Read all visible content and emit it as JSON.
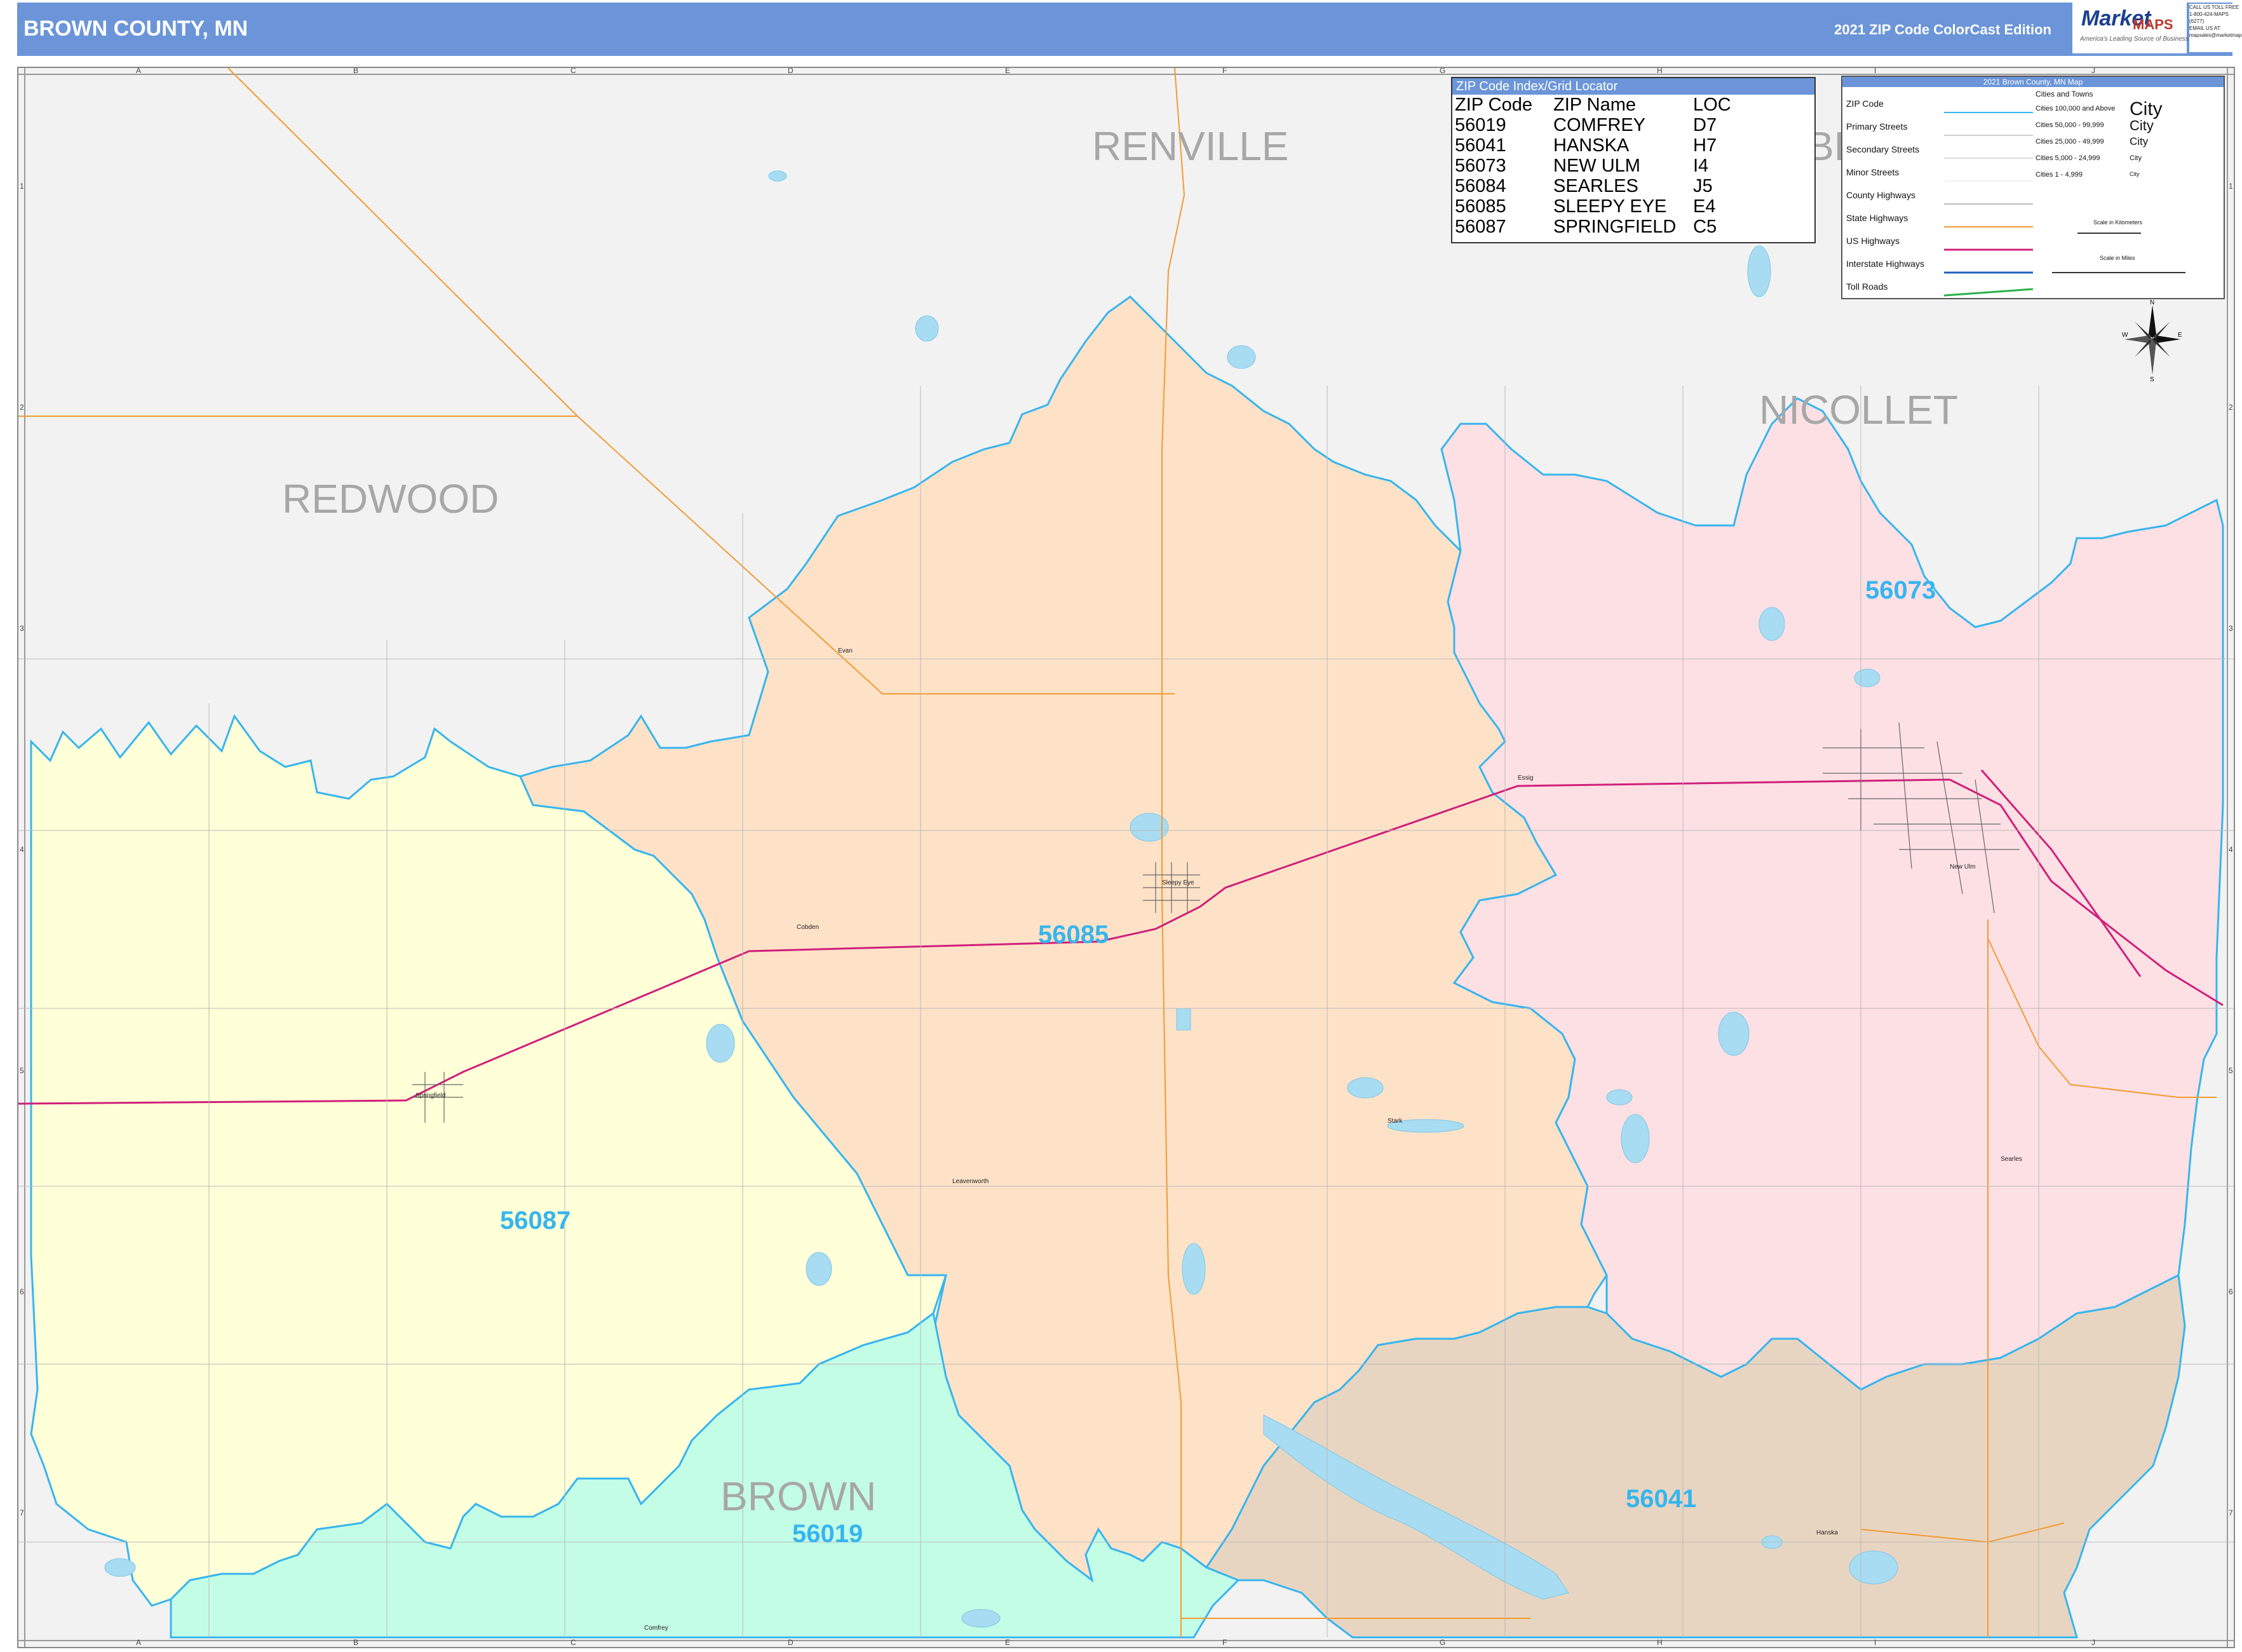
{
  "header": {
    "title": "BROWN COUNTY, MN",
    "edition": "2021 ZIP Code ColorCast Edition"
  },
  "brand": {
    "logo_word1": "Market",
    "logo_word2": "MAPS",
    "tagline": "America's Leading Source of Business Maps",
    "contact": [
      "CALL US TOLL FREE",
      "1-800-424-MAPS (6277)",
      "EMAIL US AT:",
      "mapsales@marketmaps.com"
    ]
  },
  "colors": {
    "header_bg": "#6b95d8",
    "zip_label": "#36b5ef",
    "zip_boundary": "#36b5ef",
    "zip_56085": "#fde2c8",
    "zip_56087": "#ffffd8",
    "zip_56019": "#c4fde6",
    "zip_56073": "#fde0e4",
    "zip_56041": "#e8d5c1",
    "outside": "#f2f2f2",
    "us_highway": "#d01f7a",
    "state_highway": "#f29b32",
    "water": "#a8dcf2"
  },
  "grid": {
    "columns": [
      "A",
      "B",
      "C",
      "D",
      "E",
      "F",
      "G",
      "H",
      "I",
      "J"
    ],
    "rows": [
      "1",
      "2",
      "3",
      "4",
      "5",
      "6",
      "7"
    ]
  },
  "county_labels": [
    "RENVILLE",
    "REDWOOD",
    "NICOLLET",
    "BROWN",
    "BL"
  ],
  "zip_labels": [
    "56073",
    "56085",
    "56087",
    "56041",
    "56019"
  ],
  "town_labels": [
    "Sleepy Eye",
    "New Ulm",
    "Springfield",
    "Hanska",
    "Comfrey",
    "Searles",
    "Evan",
    "Cobden",
    "Leavenworth",
    "Stark",
    "Essig"
  ],
  "zip_index": {
    "heading": "ZIP Code Index/Grid Locator",
    "columns": [
      "ZIP Code",
      "ZIP Name",
      "LOC"
    ],
    "rows": [
      [
        "56019",
        "COMFREY",
        "D7"
      ],
      [
        "56041",
        "HANSKA",
        "H7"
      ],
      [
        "56073",
        "NEW ULM",
        "I4"
      ],
      [
        "56084",
        "SEARLES",
        "J5"
      ],
      [
        "56085",
        "SLEEPY EYE",
        "E4"
      ],
      [
        "56087",
        "SPRINGFIELD",
        "C5"
      ]
    ]
  },
  "legend": {
    "heading": "2021 Brown County, MN Map",
    "items": [
      "ZIP Code",
      "Primary Streets",
      "Secondary Streets",
      "Minor Streets",
      "County Highways",
      "State Highways",
      "US Highways",
      "Interstate Highways",
      "Toll Roads"
    ],
    "cities_title": "Cities and Towns",
    "city_classes": [
      "Cities 100,000 and Above",
      "Cities 50,000 - 99,999",
      "Cities 25,000 - 49,999",
      "Cities 5,000 - 24,999",
      "Cities 1 - 4,999"
    ],
    "city_symbols": [
      "City",
      "City",
      "City",
      "City",
      "City"
    ],
    "scale_km": "Scale in Kilometers",
    "scale_mi": "Scale in Miles"
  },
  "compass": {
    "n": "N",
    "s": "S",
    "e": "E",
    "w": "W"
  }
}
